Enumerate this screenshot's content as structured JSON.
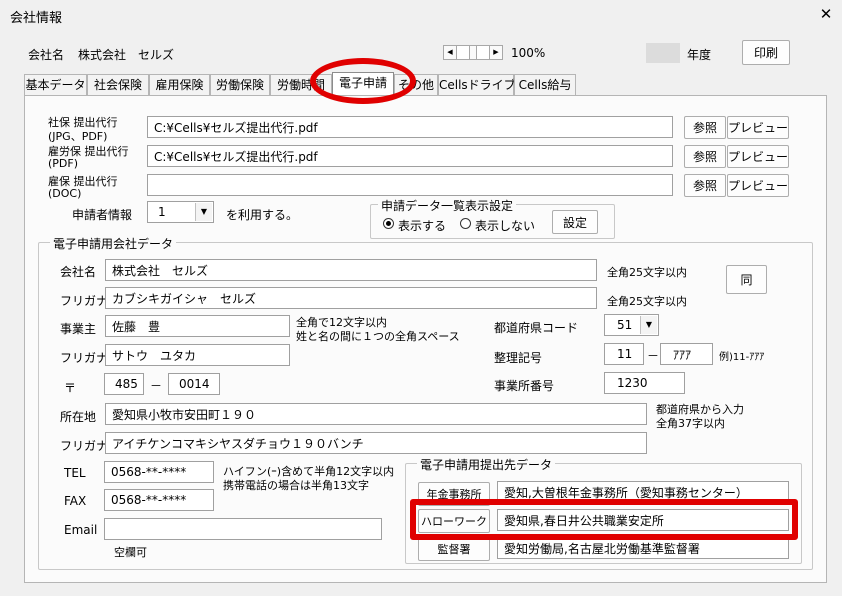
{
  "window": {
    "title": "会社情報",
    "close_glyph": "✕"
  },
  "header": {
    "company_label": "会社名",
    "company_name": "株式会社　セルズ",
    "zoom": "100%",
    "year_label": "年度",
    "print_label": "印刷"
  },
  "tabs": [
    {
      "label": "基本データ"
    },
    {
      "label": "社会保険"
    },
    {
      "label": "雇用保険"
    },
    {
      "label": "労働保険"
    },
    {
      "label": "労働時間"
    },
    {
      "label": "電子申請"
    },
    {
      "label": "その他"
    },
    {
      "label": "Cellsドライブ"
    },
    {
      "label": "Cells給与"
    }
  ],
  "proxy": {
    "rows": [
      {
        "label1": "社保 提出代行",
        "label2": "(JPG、PDF)",
        "value": "C:¥Cells¥セルズ提出代行.pdf"
      },
      {
        "label1": "雇労保 提出代行",
        "label2": "(PDF)",
        "value": "C:¥Cells¥セルズ提出代行.pdf"
      },
      {
        "label1": "雇保 提出代行",
        "label2": "(DOC)",
        "value": ""
      }
    ],
    "browse_label": "参照",
    "preview_label": "プレビュー"
  },
  "applicant": {
    "label": "申請者情報",
    "value": "1",
    "suffix": "を利用する。"
  },
  "list_display": {
    "title": "申請データ一覧表示設定",
    "option_show": "表示する",
    "option_hide": "表示しない",
    "selected": "show",
    "settings_label": "設定"
  },
  "company_data": {
    "group_title": "電子申請用会社データ",
    "name_label": "会社名",
    "name_value": "株式会社　セルズ",
    "name_note": "全角25文字以内",
    "kana_label": "フリガナ",
    "kana_value": "カブシキガイシャ　セルズ",
    "kana_note": "全角25文字以内",
    "same_label": "同",
    "owner_label": "事業主",
    "owner_value": "佐藤　豊",
    "owner_note1": "全角で12文字以内",
    "owner_note2": "姓と名の間に１つの全角スペース",
    "owner_kana_label": "フリガナ",
    "owner_kana_value": "サトウ　ユタカ",
    "pref_code_label": "都道府県コード",
    "pref_code_value": "51",
    "ref_label": "整理記号",
    "ref_value1": "11",
    "ref_dash": "－",
    "ref_value2": "ｱｱｱ",
    "ref_example": "例)11-ｱｱｱ",
    "zip_label": "〒",
    "zip1": "485",
    "zip_dash": "－",
    "zip2": "0014",
    "office_no_label": "事業所番号",
    "office_no_value": "1230",
    "address_label": "所在地",
    "address_value": "愛知県小牧市安田町１９０",
    "address_note1": "都道府県から入力",
    "address_note2": "全角37字以内",
    "address_kana_label": "フリガナ",
    "address_kana_value": "アイチケンコマキシヤスダチョウ１９０バンチ",
    "tel_label": "TEL",
    "tel_value": "0568-**-****",
    "tel_note1": "ハイフン(ｰ)含めて半角12文字以内",
    "tel_note2": "携帯電話の場合は半角13文字",
    "fax_label": "FAX",
    "fax_value": "0568-**-****",
    "email_label": "Email",
    "email_value": "",
    "email_note": "空欄可"
  },
  "submission": {
    "group_title": "電子申請用提出先データ",
    "rows": [
      {
        "button": "年金事務所",
        "value": "愛知,大曽根年金事務所（愛知事務センター）"
      },
      {
        "button": "ハローワーク",
        "value": "愛知県,春日井公共職業安定所"
      },
      {
        "button": "監督署",
        "value": "愛知労働局,名古屋北労働基準監督署"
      }
    ]
  },
  "colors": {
    "annotation": "#e00000"
  }
}
